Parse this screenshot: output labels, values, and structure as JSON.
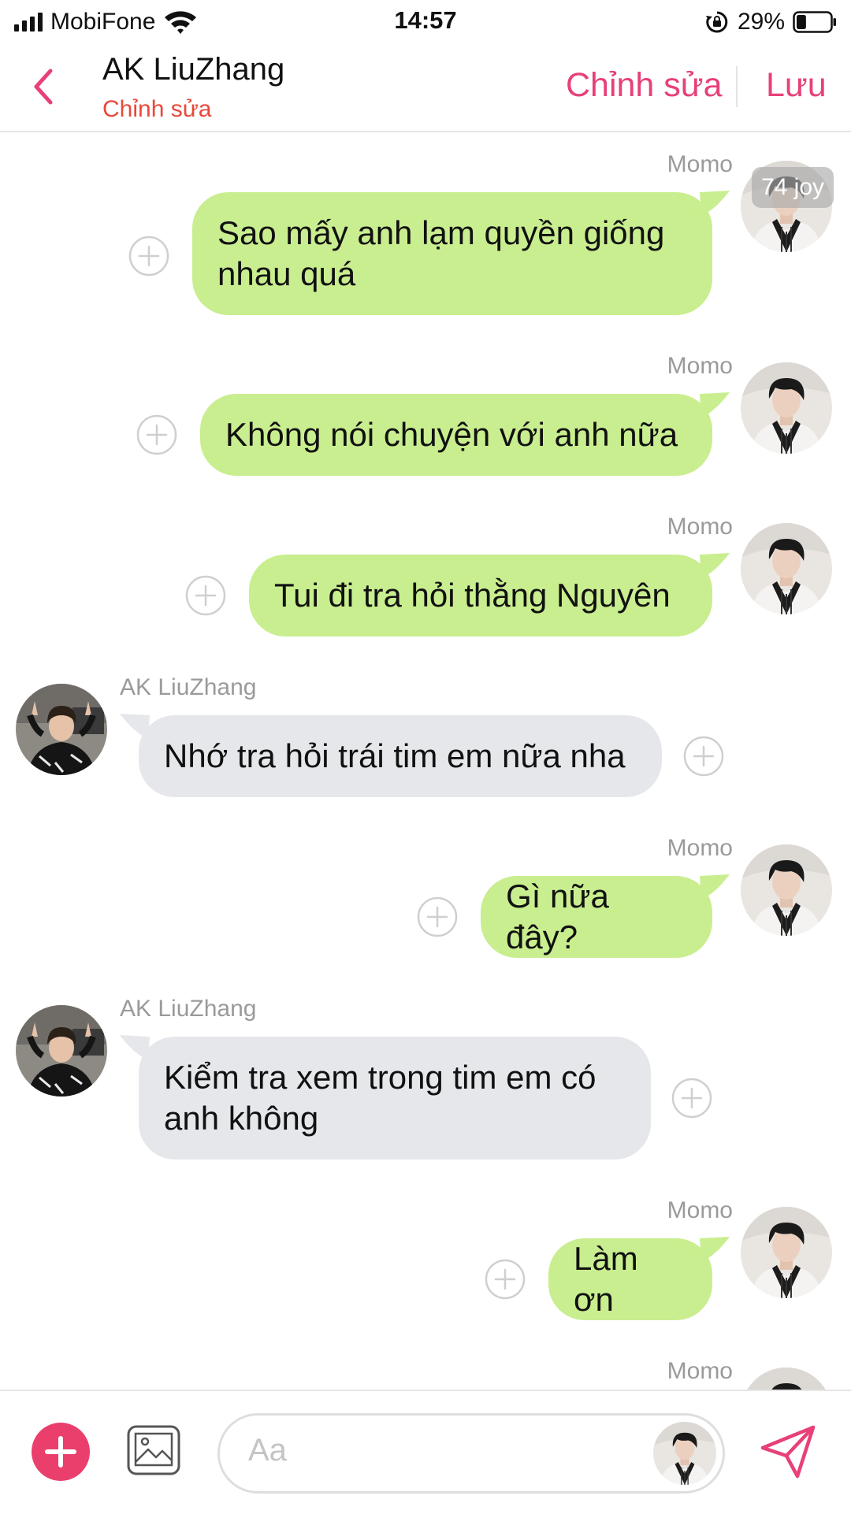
{
  "status_bar": {
    "carrier": "MobiFone",
    "time": "14:57",
    "battery": "29%",
    "battery_level": 0.29
  },
  "header": {
    "contact_name": "AK LiuZhang",
    "subtitle": "Chỉnh sửa",
    "edit_label": "Chỉnh sửa",
    "save_label": "Lưu",
    "accent_color": "#e7407a"
  },
  "chat": {
    "joy_badge": "74 joy",
    "messages": [
      {
        "sender": "Momo",
        "side": "right",
        "lines": [
          "Sao mấy anh lạm quyền giống",
          "nhau quá"
        ]
      },
      {
        "sender": "Momo",
        "side": "right",
        "lines": [
          "Không nói chuyện với anh nữa"
        ]
      },
      {
        "sender": "Momo",
        "side": "right",
        "lines": [
          "Tui đi tra hỏi thằng Nguyên"
        ]
      },
      {
        "sender": "AK LiuZhang",
        "side": "left",
        "lines": [
          "Nhớ tra hỏi trái tim em nữa nha"
        ]
      },
      {
        "sender": "Momo",
        "side": "right",
        "lines": [
          "Gì nữa đây?"
        ]
      },
      {
        "sender": "AK LiuZhang",
        "side": "left",
        "lines": [
          "Kiểm tra xem trong tim em có",
          "anh không"
        ]
      },
      {
        "sender": "Momo",
        "side": "right",
        "lines": [
          "Làm ơn"
        ]
      },
      {
        "sender": "Momo",
        "side": "right",
        "lines": []
      }
    ]
  },
  "composer": {
    "placeholder": "Aa"
  },
  "colors": {
    "my_bubble": "#c9ee8f",
    "their_bubble": "#e5e7ea",
    "add_button": "#ea3f6d"
  }
}
